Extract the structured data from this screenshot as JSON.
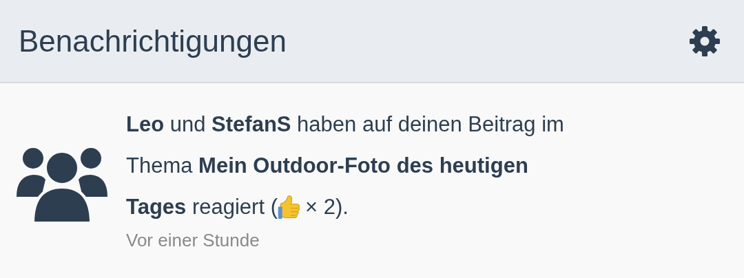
{
  "header": {
    "title": "Benachrichtigungen"
  },
  "notifications": [
    {
      "lines": [
        "**Leo** und **StefanS** haben auf deinen Beitrag im",
        "Thema **Mein Outdoor-Foto des heutigen**",
        "**Tages** reagiert ("
      ],
      "reaction_suffix": "× 2).",
      "time": "Vor einer Stunde"
    }
  ]
}
